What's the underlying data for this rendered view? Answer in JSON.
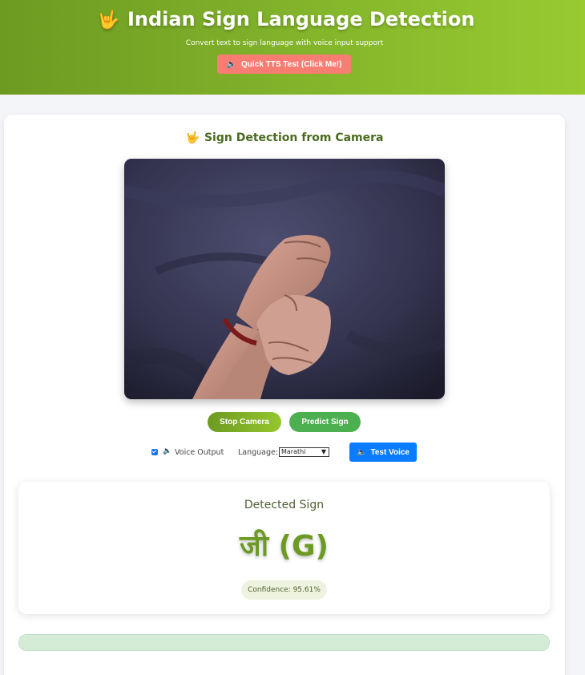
{
  "header": {
    "title": "Indian Sign Language Detection",
    "title_icon": "hand-sign-icon",
    "subtitle": "Convert text to sign language with voice input support",
    "tts_button_label": "Quick TTS Test (Click Me!)"
  },
  "camera_card": {
    "title": "Sign Detection from Camera",
    "stop_button_label": "Stop Camera",
    "predict_button_label": "Predict Sign"
  },
  "controls": {
    "voice_output_checked": true,
    "voice_output_label": "Voice Output",
    "language_label": "Language:",
    "language_selected": "Marathi",
    "test_voice_label": "Test Voice"
  },
  "result": {
    "title": "Detected Sign",
    "sign": "जी (G)",
    "confidence": "Confidence: 95.61%"
  },
  "colors": {
    "accent_green": "#6d9a22",
    "tts_button": "#f77d73",
    "predict_button": "#4caf50",
    "test_voice_button": "#0a7cff"
  }
}
